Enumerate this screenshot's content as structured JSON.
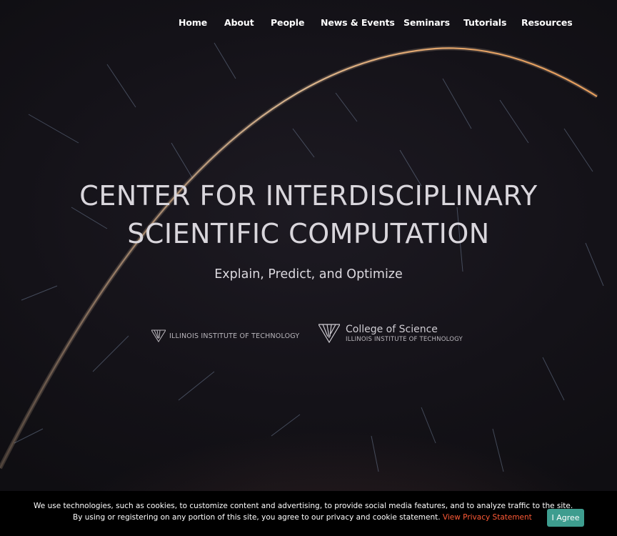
{
  "nav": {
    "items": [
      {
        "label": "Home"
      },
      {
        "label": "About"
      },
      {
        "label": "People"
      },
      {
        "label": "News & Events"
      },
      {
        "label": "Seminars"
      },
      {
        "label": "Tutorials"
      },
      {
        "label": "Resources"
      }
    ]
  },
  "hero": {
    "title_line1": "CENTER FOR INTERDISCIPLINARY",
    "title_line2": "SCIENTIFIC COMPUTATION",
    "tagline": "Explain, Predict, and Optimize"
  },
  "logos": {
    "iit": {
      "text": "ILLINOIS INSTITUTE OF TECHNOLOGY",
      "icon": "iit-emblem-icon"
    },
    "college": {
      "title": "College of Science",
      "subtitle": "ILLINOIS INSTITUTE OF TECHNOLOGY",
      "icon": "iit-emblem-icon"
    }
  },
  "cookie": {
    "line1": "We use technologies, such as cookies, to customize content and advertising, to provide social media features, and to analyze traffic to the site.",
    "line2": "By using or registering on any portion of this site, you agree to our privacy and cookie statement. ",
    "link_label": "View Privacy Statement",
    "agree_label": "I Agree"
  },
  "colors": {
    "accent_button": "#3e9d8f",
    "link": "#ff5a36",
    "background": "#16141a"
  }
}
